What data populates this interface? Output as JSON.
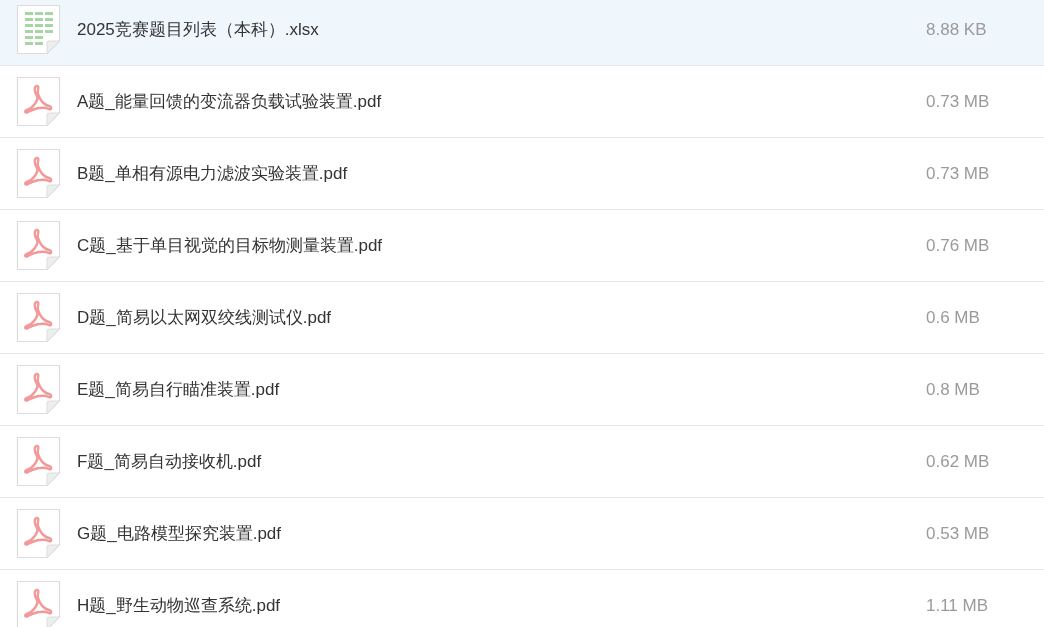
{
  "files": [
    {
      "kind": "xlsx",
      "name": "2025竞赛题目列表（本科）.xlsx",
      "size": "8.88 KB",
      "selected": true
    },
    {
      "kind": "pdf",
      "name": "A题_能量回馈的变流器负载试验装置.pdf",
      "size": "0.73 MB",
      "selected": false
    },
    {
      "kind": "pdf",
      "name": "B题_单相有源电力滤波实验装置.pdf",
      "size": "0.73 MB",
      "selected": false
    },
    {
      "kind": "pdf",
      "name": "C题_基于单目视觉的目标物测量装置.pdf",
      "size": "0.76 MB",
      "selected": false
    },
    {
      "kind": "pdf",
      "name": "D题_简易以太网双绞线测试仪.pdf",
      "size": "0.6 MB",
      "selected": false
    },
    {
      "kind": "pdf",
      "name": "E题_简易自行瞄准装置.pdf",
      "size": "0.8 MB",
      "selected": false
    },
    {
      "kind": "pdf",
      "name": "F题_简易自动接收机.pdf",
      "size": "0.62 MB",
      "selected": false
    },
    {
      "kind": "pdf",
      "name": "G题_电路模型探究装置.pdf",
      "size": "0.53 MB",
      "selected": false
    },
    {
      "kind": "pdf",
      "name": "H题_野生动物巡查系统.pdf",
      "size": "1.11 MB",
      "selected": false
    }
  ]
}
